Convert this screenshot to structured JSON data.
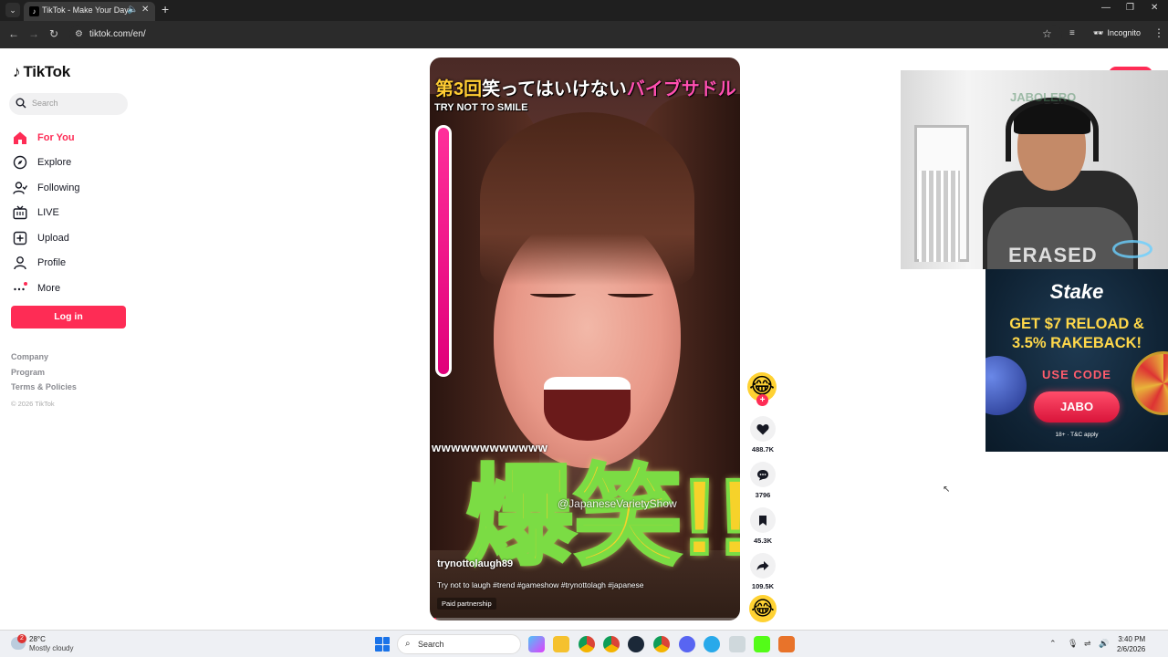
{
  "browser": {
    "tab_title": "TikTok - Make Your Day",
    "url": "tiktok.com/en/",
    "incognito_label": "Incognito"
  },
  "sidebar": {
    "logo_text": "TikTok",
    "search_placeholder": "Search",
    "nav_items": [
      {
        "label": "For You",
        "icon": "home-icon",
        "active": true
      },
      {
        "label": "Explore",
        "icon": "compass-icon"
      },
      {
        "label": "Following",
        "icon": "following-icon"
      },
      {
        "label": "LIVE",
        "icon": "live-icon"
      },
      {
        "label": "Upload",
        "icon": "upload-icon"
      },
      {
        "label": "Profile",
        "icon": "profile-icon"
      },
      {
        "label": "More",
        "icon": "more-icon"
      }
    ],
    "login_label": "Log in",
    "footer_links": [
      "Company",
      "Program",
      "Terms & Policies"
    ],
    "copyright": "© 2026 TikTok"
  },
  "video": {
    "banner_prefix": "第3回",
    "banner_middle": "笑ってはいけない",
    "banner_suffix": "バイブサドル",
    "subtitle": "TRY NOT TO SMILE",
    "laugh_text": "wwwwwwwwwwww",
    "big_text": "爆笑!!",
    "watermark": "@JapaneseVarietyShow",
    "author": "trynottolaugh89",
    "caption": "Try not to laugh #trend #gameshow #trynottolagh #japanese",
    "paid_label": "Paid partnership",
    "progress_fraction": 0.02
  },
  "actions": {
    "likes": "488.7K",
    "comments": "3796",
    "saves": "45.3K",
    "shares": "109.5K"
  },
  "overlay": {
    "cam_watermark": "JABOLERO",
    "shirt_text": "ERASED",
    "stake_logo": "Stake",
    "stake_headline_1": "GET $7 RELOAD &",
    "stake_headline_2": "3.5% RAKEBACK!",
    "stake_use_code": "USE CODE",
    "stake_code": "JABO",
    "stake_tc": "18+ · T&C apply"
  },
  "taskbar": {
    "temperature": "28°C",
    "weather": "Mostly cloudy",
    "weather_badge": "2",
    "search_placeholder": "Search",
    "time": "3:40 PM",
    "date": "2/6/2026"
  },
  "colors": {
    "brand": "#fe2c55",
    "stake_yellow": "#ffd84a"
  }
}
